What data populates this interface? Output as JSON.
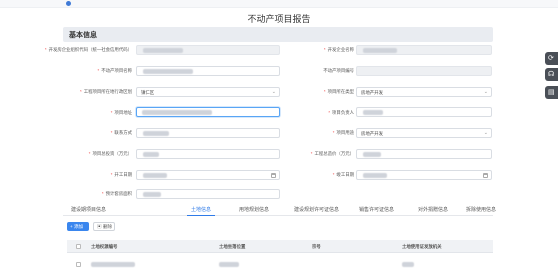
{
  "page": {
    "title": "不动产项目报告"
  },
  "section": {
    "title": "基本信息"
  },
  "form": {
    "dev_unit_code": {
      "label": "开发房企业组织代码（统一社会信用代码）"
    },
    "dev_unit_name": {
      "label": "开发企业名称"
    },
    "project_name": {
      "label": "不动产项目名称"
    },
    "project_code": {
      "label": "不动产项目编号"
    },
    "region": {
      "label": "工程项目所在地行政区划",
      "value": "镇仁区"
    },
    "project_type": {
      "label": "项目所在类型",
      "value": "房地产开发"
    },
    "project_address": {
      "label": "项目地址"
    },
    "project_manager": {
      "label": "项目负责人"
    },
    "contact": {
      "label": "联系方式"
    },
    "project_use": {
      "label": "项目用途",
      "value": "房地产开发"
    },
    "total_investment": {
      "label": "项目总投资（万元）"
    },
    "project_cost": {
      "label": "工程总造价（万元）"
    },
    "start_date": {
      "label": "开工日期"
    },
    "end_date": {
      "label": "竣工日期"
    },
    "total_area": {
      "label": "预计套房面积"
    }
  },
  "tabs": [
    {
      "label": "建设期项目信息",
      "active": false
    },
    {
      "label": "土地信息",
      "active": true
    },
    {
      "label": "用地规划信息",
      "active": false
    },
    {
      "label": "建设规划许可证信息",
      "active": false
    },
    {
      "label": "销售许可证信息",
      "active": false
    },
    {
      "label": "对外捐赠信息",
      "active": false
    },
    {
      "label": "拆除使用信息",
      "active": false
    }
  ],
  "toolbar": {
    "add_label": "+ 添加",
    "delete_label": "删除"
  },
  "table": {
    "columns": [
      "土地权源编号",
      "土地坐落位置",
      "宗号",
      "土地使用证发放机关"
    ]
  },
  "colors": {
    "accent": "#2f7be8",
    "required": "#f05050"
  },
  "icons": [
    "refresh-icon",
    "headset-icon",
    "document-icon",
    "calendar-icon",
    "chevron-down-icon"
  ]
}
